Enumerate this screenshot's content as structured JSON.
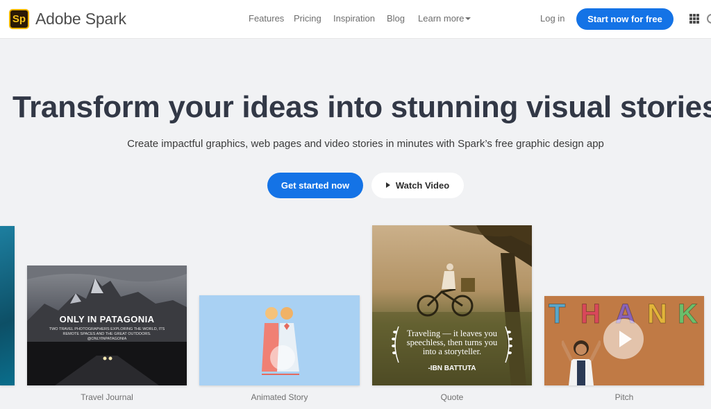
{
  "header": {
    "logo_badge": "Sp",
    "brand": "Adobe Spark",
    "nav": [
      "Features",
      "Pricing",
      "Inspiration",
      "Blog",
      "Learn more"
    ],
    "login": "Log in",
    "cta": "Start now for free",
    "icons": [
      "apps-grid-icon",
      "user-icon"
    ]
  },
  "hero": {
    "headline": "Transform your ideas into stunning visual stories",
    "subhead": "Create impactful graphics, web pages and video stories in minutes with Spark’s free graphic design app",
    "primary_button": "Get started now",
    "secondary_button": "Watch Video"
  },
  "gallery": {
    "cards": [
      {
        "label": "Travel Journal",
        "title": "ONLY IN PATAGONIA",
        "caption": "TWO TRAVEL PHOTOGRAPHERS EXPLORING THE WORLD, ITS REMOTE SPACES AND THE GREAT OUTDOORS. @ONLYINPATAGONIA"
      },
      {
        "label": "Animated Story"
      },
      {
        "label": "Quote",
        "quote": "Traveling — it leaves you speechless, then turns you into a storyteller.",
        "author": "-IBN BATTUTA"
      },
      {
        "label": "Pitch",
        "thank_letters": [
          "T",
          "H",
          "A",
          "N",
          "K"
        ]
      }
    ]
  },
  "colors": {
    "accent": "#1473e6",
    "background": "#f1f2f4",
    "headline": "#323846",
    "logo_yellow": "#f5c21b"
  }
}
